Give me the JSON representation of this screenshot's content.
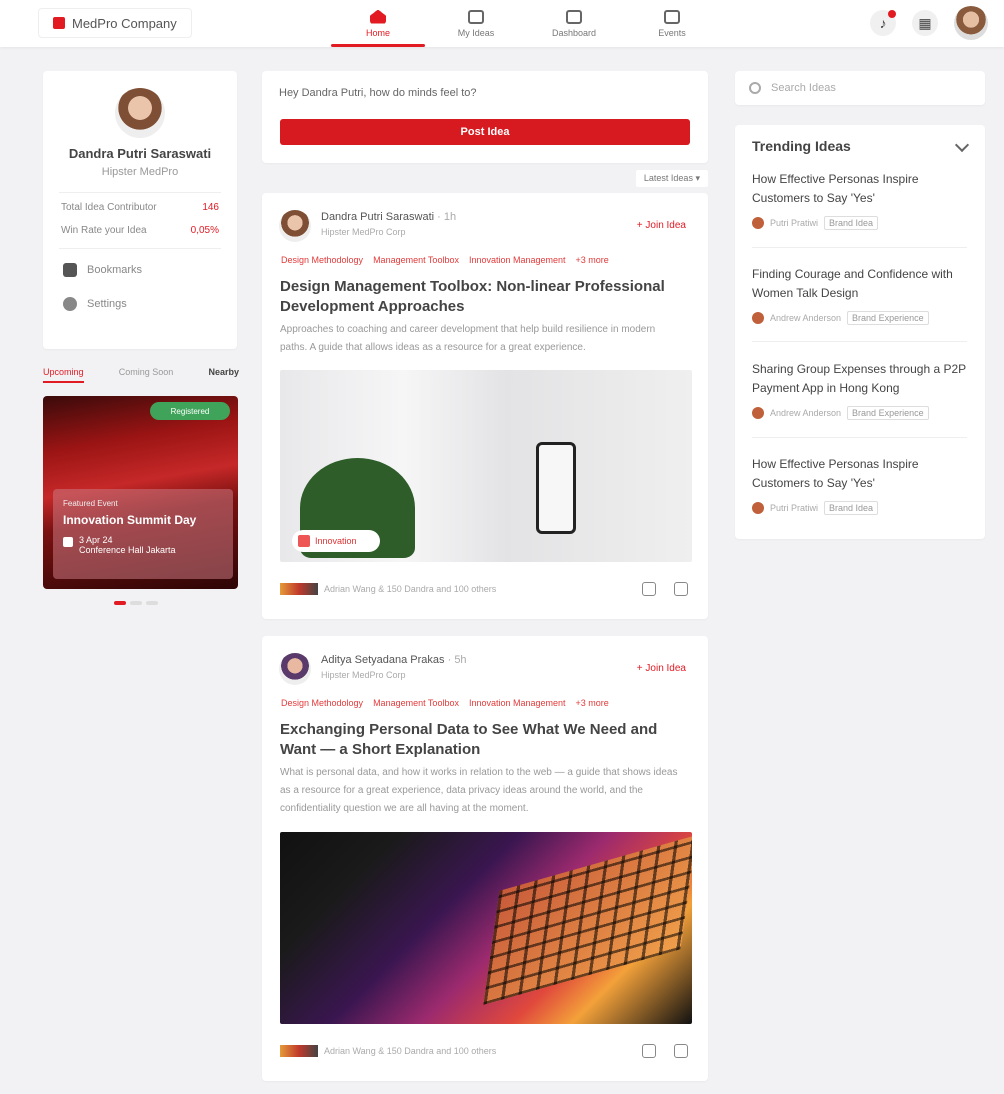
{
  "brand": {
    "name": "MedPro Company"
  },
  "nav": [
    {
      "label": "Home",
      "active": true
    },
    {
      "label": "My Ideas"
    },
    {
      "label": "Dashboard"
    },
    {
      "label": "Events"
    }
  ],
  "profile": {
    "name": "Dandra Putri Saraswati",
    "role": "Hipster MedPro",
    "stats": [
      {
        "label": "Total Idea Contributor",
        "value": "146"
      },
      {
        "label": "Win Rate your Idea",
        "value": "0,05%"
      }
    ],
    "menu": [
      {
        "label": "Bookmarks",
        "icon": "bookmark-icon"
      },
      {
        "label": "Settings",
        "icon": "gear-icon"
      }
    ]
  },
  "left_tabs": [
    {
      "label": "Upcoming"
    },
    {
      "label": "Coming Soon"
    },
    {
      "label": "Nearby"
    }
  ],
  "event": {
    "badge": "Registered",
    "subtitle": "Featured Event",
    "title": "Innovation Summit Day",
    "date": "3 Apr 24",
    "location": "Conference Hall Jakarta"
  },
  "composer": {
    "question": "Hey Dandra Putri, how do minds feel to?",
    "button": "Post Idea"
  },
  "sort": "Latest Ideas",
  "posts": [
    {
      "author": "Dandra Putri Saraswati",
      "time": "· 1h",
      "role": "Hipster MedPro Corp",
      "join": "Join Idea",
      "tags": [
        "Design Methodology",
        "Management Toolbox",
        "Innovation Management",
        "+3 more"
      ],
      "title": "Design Management Toolbox: Non-linear Professional Development Approaches",
      "desc": "Approaches to coaching and career development that help build resilience in modern paths. A guide that allows ideas as a resource for a great experience.",
      "chip": "Innovation",
      "footer": "Adrian Wang & 150 Dandra and 100 others"
    },
    {
      "author": "Aditya Setyadana Prakas",
      "time": "· 5h",
      "role": "Hipster MedPro Corp",
      "join": "Join Idea",
      "tags": [
        "Design Methodology",
        "Management Toolbox",
        "Innovation Management",
        "+3 more"
      ],
      "title": "Exchanging Personal Data to See What We Need and Want — a Short Explanation",
      "desc": "What is personal data, and how it works in relation to the web — a guide that shows ideas as a resource for a great experience, data privacy ideas around the world, and the confidentiality question we are all having at the moment.",
      "footer": "Adrian Wang & 150 Dandra and 100 others"
    }
  ],
  "search": {
    "placeholder": "Search Ideas"
  },
  "trending": {
    "title": "Trending Ideas",
    "items": [
      {
        "title": "How Effective Personas Inspire Customers to Say 'Yes'",
        "author": "Putri Pratiwi",
        "tag": "Brand Idea"
      },
      {
        "title": "Finding Courage and Confidence with Women Talk Design",
        "author": "Andrew Anderson",
        "tag": "Brand Experience"
      },
      {
        "title": "Sharing Group Expenses through a P2P Payment App in Hong Kong",
        "author": "Andrew Anderson",
        "tag": "Brand Experience"
      },
      {
        "title": "How Effective Personas Inspire Customers to Say 'Yes'",
        "author": "Putri Pratiwi",
        "tag": "Brand Idea"
      }
    ]
  },
  "colors": {
    "accent": "#e21b23",
    "background": "#f2f2f4"
  }
}
